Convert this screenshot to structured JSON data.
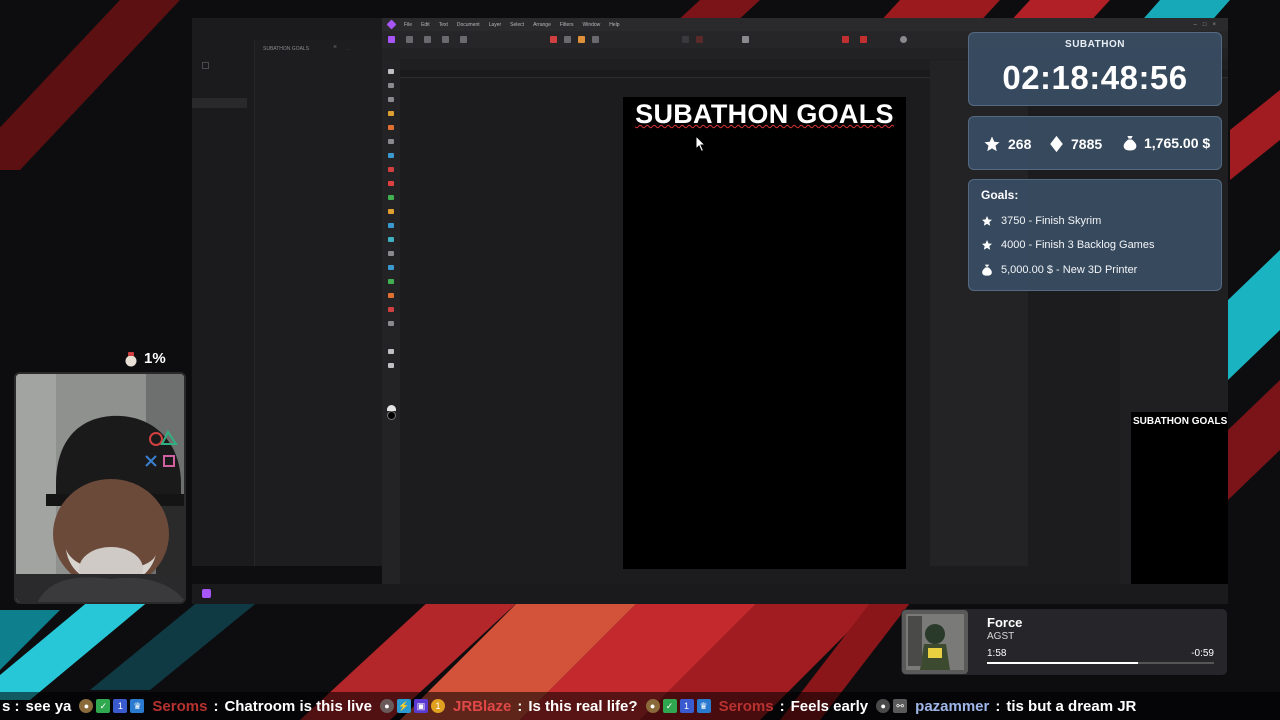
{
  "app": {
    "menus": [
      "File",
      "Edit",
      "Text",
      "Document",
      "Layer",
      "Select",
      "Arrange",
      "Filters",
      "Window",
      "Help"
    ],
    "left_panel_tab": "SUBATHON GOALS",
    "artboard_title": "SUBATHON GOALS",
    "preview_title": "SUBATHON GOALS"
  },
  "subathon": {
    "label": "SUBATHON",
    "timer": "02:18:48:56",
    "stats": {
      "subs": "268",
      "bits": "7885",
      "money": "1,765.00 $"
    },
    "goals_title": "Goals:",
    "goals": [
      {
        "icon": "star-icon",
        "text": "3750 - Finish Skyrim"
      },
      {
        "icon": "star-icon",
        "text": "4000 - Finish 3 Backlog Games"
      },
      {
        "icon": "money-bag-icon",
        "text": "5,000.00 $ - New 3D Printer"
      }
    ]
  },
  "webcam": {
    "percent": "1%"
  },
  "now_playing": {
    "title": "Force",
    "artist": "AGST",
    "elapsed": "1:58",
    "remaining": "-0:59",
    "progress": 0.667
  },
  "ticker": [
    {
      "user": "",
      "message": "see ya",
      "user_color": "#ffffff"
    },
    {
      "user": "Seroms",
      "message": "Chatroom is this live",
      "user_color": "#c0392b"
    },
    {
      "user": "JRBlaze",
      "message": "Is this real life?",
      "user_color": "#e05050"
    },
    {
      "user": "Seroms",
      "message": "Feels early",
      "user_color": "#c0392b"
    },
    {
      "user": "pazammer",
      "message": "tis but a dream JR",
      "user_color": "#9fb6e8"
    }
  ],
  "colors": {
    "card_bg": "#3a4d63",
    "accent_purple": "#a855f7",
    "stripe_red": "#c0262a",
    "stripe_cyan": "#2ec4d6"
  }
}
